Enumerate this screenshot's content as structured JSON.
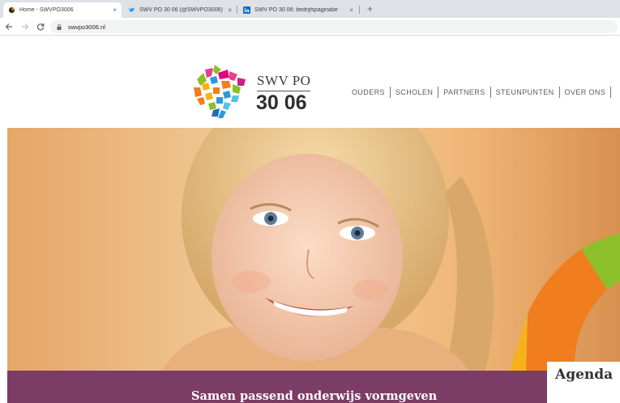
{
  "browser": {
    "tabs": [
      {
        "title": "Home - SWVPO3006",
        "icon": "site-favicon"
      },
      {
        "title": "SWV PO 30 06 (@SWVPO3006) / ",
        "icon": "twitter-icon"
      },
      {
        "title": "SWV PO 30 06: bedrijfspaginabe",
        "icon": "linkedin-icon"
      }
    ],
    "new_tab": "+",
    "close_glyph": "×",
    "url": "swvpo3006.nl"
  },
  "site": {
    "brand_top": "SWV PO",
    "brand_bottom": "30 06",
    "nav": [
      "OUDERS",
      "SCHOLEN",
      "PARTNERS",
      "STEUNPUNTEN",
      "OVER ONS"
    ],
    "banner_text": "Samen passend onderwijs vormgeven",
    "agenda_label": "Agenda"
  },
  "colors": {
    "banner": "#7b3c65",
    "accent_orange": "#f07d1e",
    "accent_green": "#8dbf2a"
  }
}
